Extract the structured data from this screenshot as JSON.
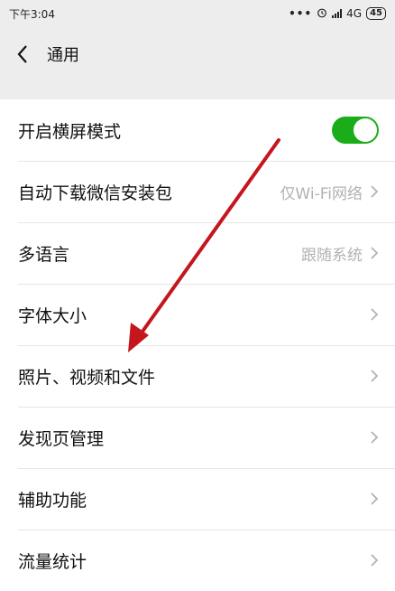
{
  "status_bar": {
    "time": "下午3:04",
    "network": "4G",
    "battery": "45"
  },
  "nav": {
    "title": "通用"
  },
  "settings": [
    {
      "label": "开启横屏模式",
      "value": "",
      "toggle": true,
      "toggle_on": true
    },
    {
      "label": "自动下载微信安装包",
      "value": "仅Wi-Fi网络"
    },
    {
      "label": "多语言",
      "value": "跟随系统"
    },
    {
      "label": "字体大小",
      "value": ""
    },
    {
      "label": "照片、视频和文件",
      "value": ""
    },
    {
      "label": "发现页管理",
      "value": ""
    },
    {
      "label": "辅助功能",
      "value": ""
    },
    {
      "label": "流量统计",
      "value": ""
    }
  ],
  "colors": {
    "toggle_on": "#1aad19",
    "annotation_arrow": "#c4161c"
  }
}
